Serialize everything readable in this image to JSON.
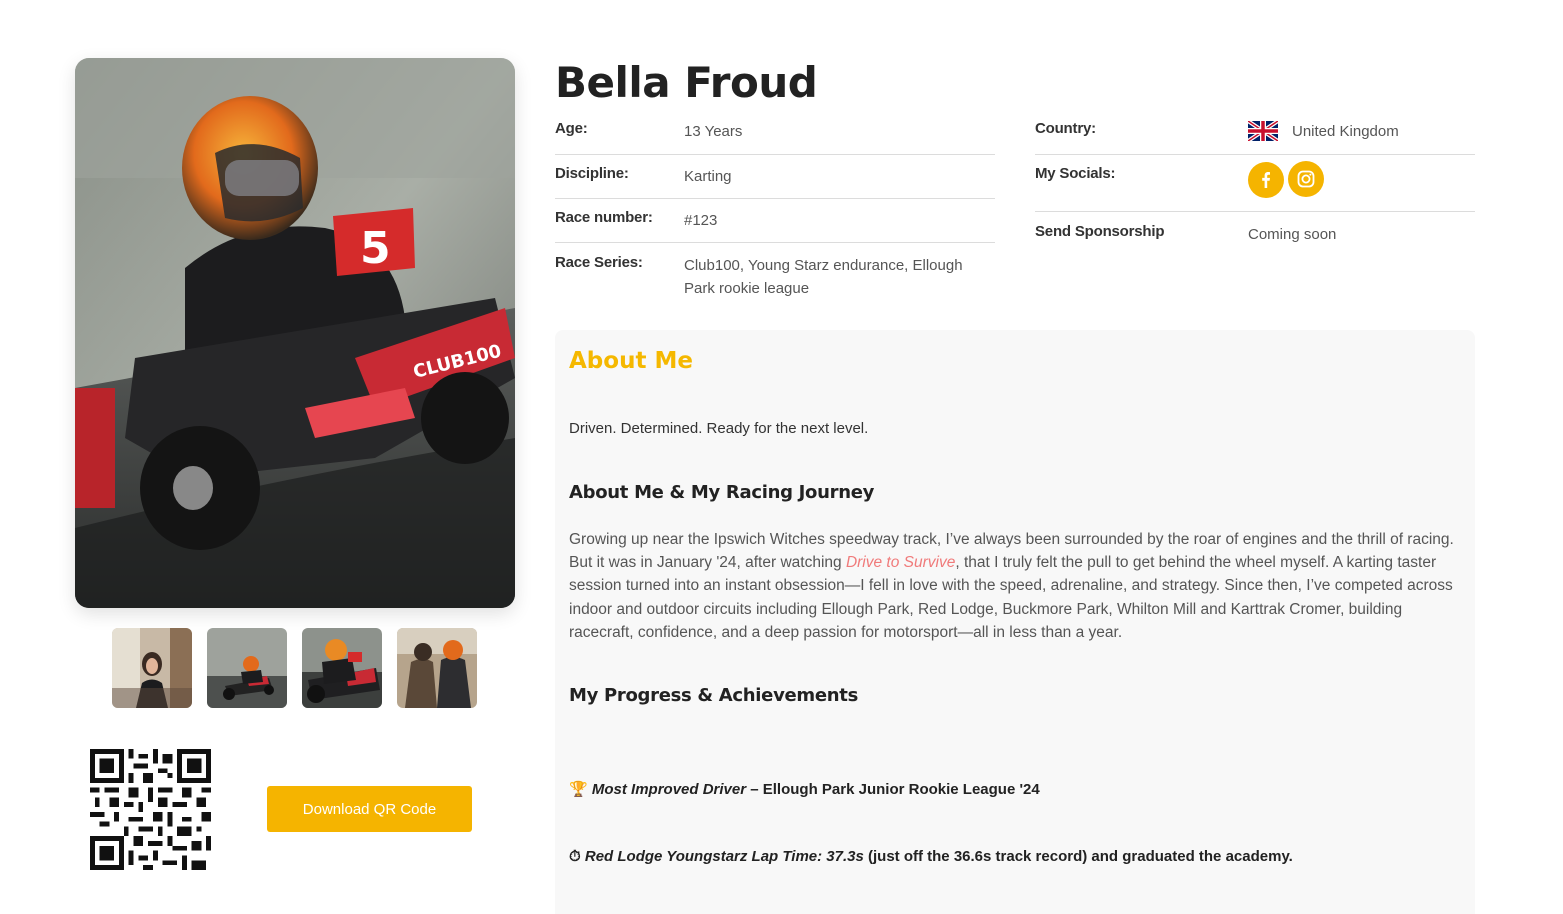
{
  "profile": {
    "name": "Bella Froud",
    "age_label": "Age:",
    "age": "13 Years",
    "discipline_label": "Discipline:",
    "discipline": "Karting",
    "race_number_label": "Race number:",
    "race_number": "#123",
    "race_series_label": "Race Series:",
    "race_series": "Club100, Young Starz endurance, Ellough Park rookie league",
    "country_label": "Country:",
    "country": "United Kingdom",
    "socials_label": "My Socials:",
    "sponsorship_label": "Send Sponsorship",
    "sponsorship_value": "Coming soon"
  },
  "icons": {
    "flag": "uk-flag-icon",
    "facebook": "facebook-icon",
    "instagram": "instagram-icon",
    "trophy": "🏆",
    "stopwatch": "⏱"
  },
  "gallery": {
    "main_kart_number": "5",
    "main_brand_text": "CLUB100"
  },
  "qr": {
    "button_label": "Download QR Code"
  },
  "about": {
    "title": "About Me",
    "tagline": "Driven. Determined. Ready for the next level.",
    "journey_heading": "About Me & My Racing Journey",
    "journey_p1": "Growing up near the Ipswich Witches speedway track, I’ve always been surrounded by the roar of engines and the thrill of racing. But it was in January '24, after watching ",
    "journey_link": "Drive to Survive",
    "journey_p2": ", that I truly felt the pull to get behind the wheel myself. A karting taster session turned into an instant obsession—I fell in love with the speed, adrenaline, and strategy. Since then, I’ve competed across indoor and outdoor circuits including Ellough Park, Red Lodge, Buckmore Park, Whilton Mill and Karttrak Cromer, building racecraft, confidence, and a deep passion for motorsport—all in less than a year.",
    "progress_heading": "My Progress & Achievements",
    "achievement1_title": "Most Improved Driver",
    "achievement1_rest": " – Ellough Park Junior Rookie League '24",
    "achievement2_title": "Red Lodge Youngstarz Lap Time: 37.3s",
    "achievement2_rest": " (just off the 36.6s track record) and graduated the academy."
  },
  "colors": {
    "accent": "#f5b400",
    "title_yellow": "#f5b800",
    "link": "#f07a7a",
    "card_bg": "#f8f8f8"
  }
}
